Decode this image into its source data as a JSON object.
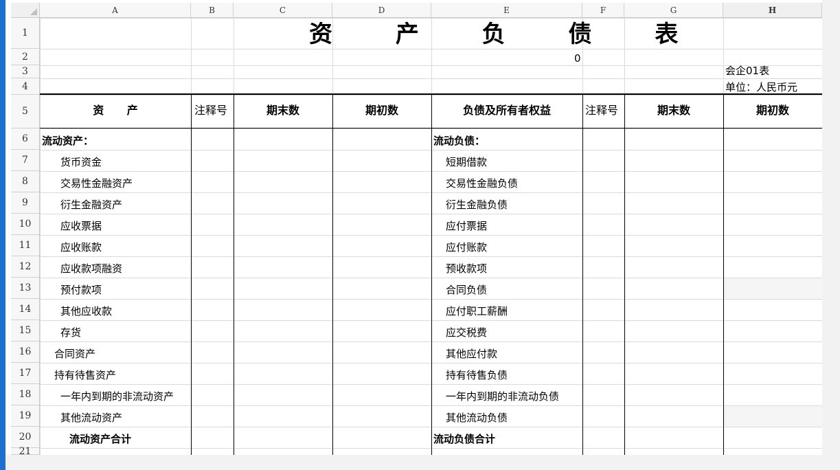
{
  "columns": [
    "A",
    "B",
    "C",
    "D",
    "E",
    "F",
    "G",
    "H"
  ],
  "rows": [
    "1",
    "2",
    "3",
    "4",
    "5",
    "6",
    "7",
    "8",
    "9",
    "10",
    "11",
    "12",
    "13",
    "14",
    "15",
    "16",
    "17",
    "18",
    "19",
    "20",
    "21"
  ],
  "title": "资 产 负 债 表",
  "row2": {
    "e_value": "0"
  },
  "form_code": "会企01表",
  "unit": "单位：人民币元",
  "header": {
    "assets": "资      产",
    "note1": "注释号",
    "end1": "期末数",
    "begin1": "期初数",
    "liab": "负债及所有者权益",
    "note2": "注释号",
    "end2": "期末数",
    "begin2": "期初数"
  },
  "assets": [
    "流动资产：",
    "货币资金",
    "交易性金融资产",
    "衍生金融资产",
    "应收票据",
    "应收账款",
    "应收款项融资",
    "预付款项",
    "其他应收款",
    "存货",
    "合同资产",
    "持有待售资产",
    "一年内到期的非流动资产",
    "其他流动资产",
    "流动资产合计"
  ],
  "liabilities": [
    "流动负债：",
    "短期借款",
    "交易性金融负债",
    "衍生金融负债",
    "应付票据",
    "应付账款",
    "预收款项",
    "合同负债",
    "应付职工薪酬",
    "应交税费",
    "其他应付款",
    "持有待售负债",
    "一年内到期的非流动负债",
    "其他流动负债",
    "流动负债合计"
  ],
  "colors": {
    "accent": "#1e6fd0",
    "grid": "#dadada",
    "header_bg": "#f7f7f7"
  }
}
